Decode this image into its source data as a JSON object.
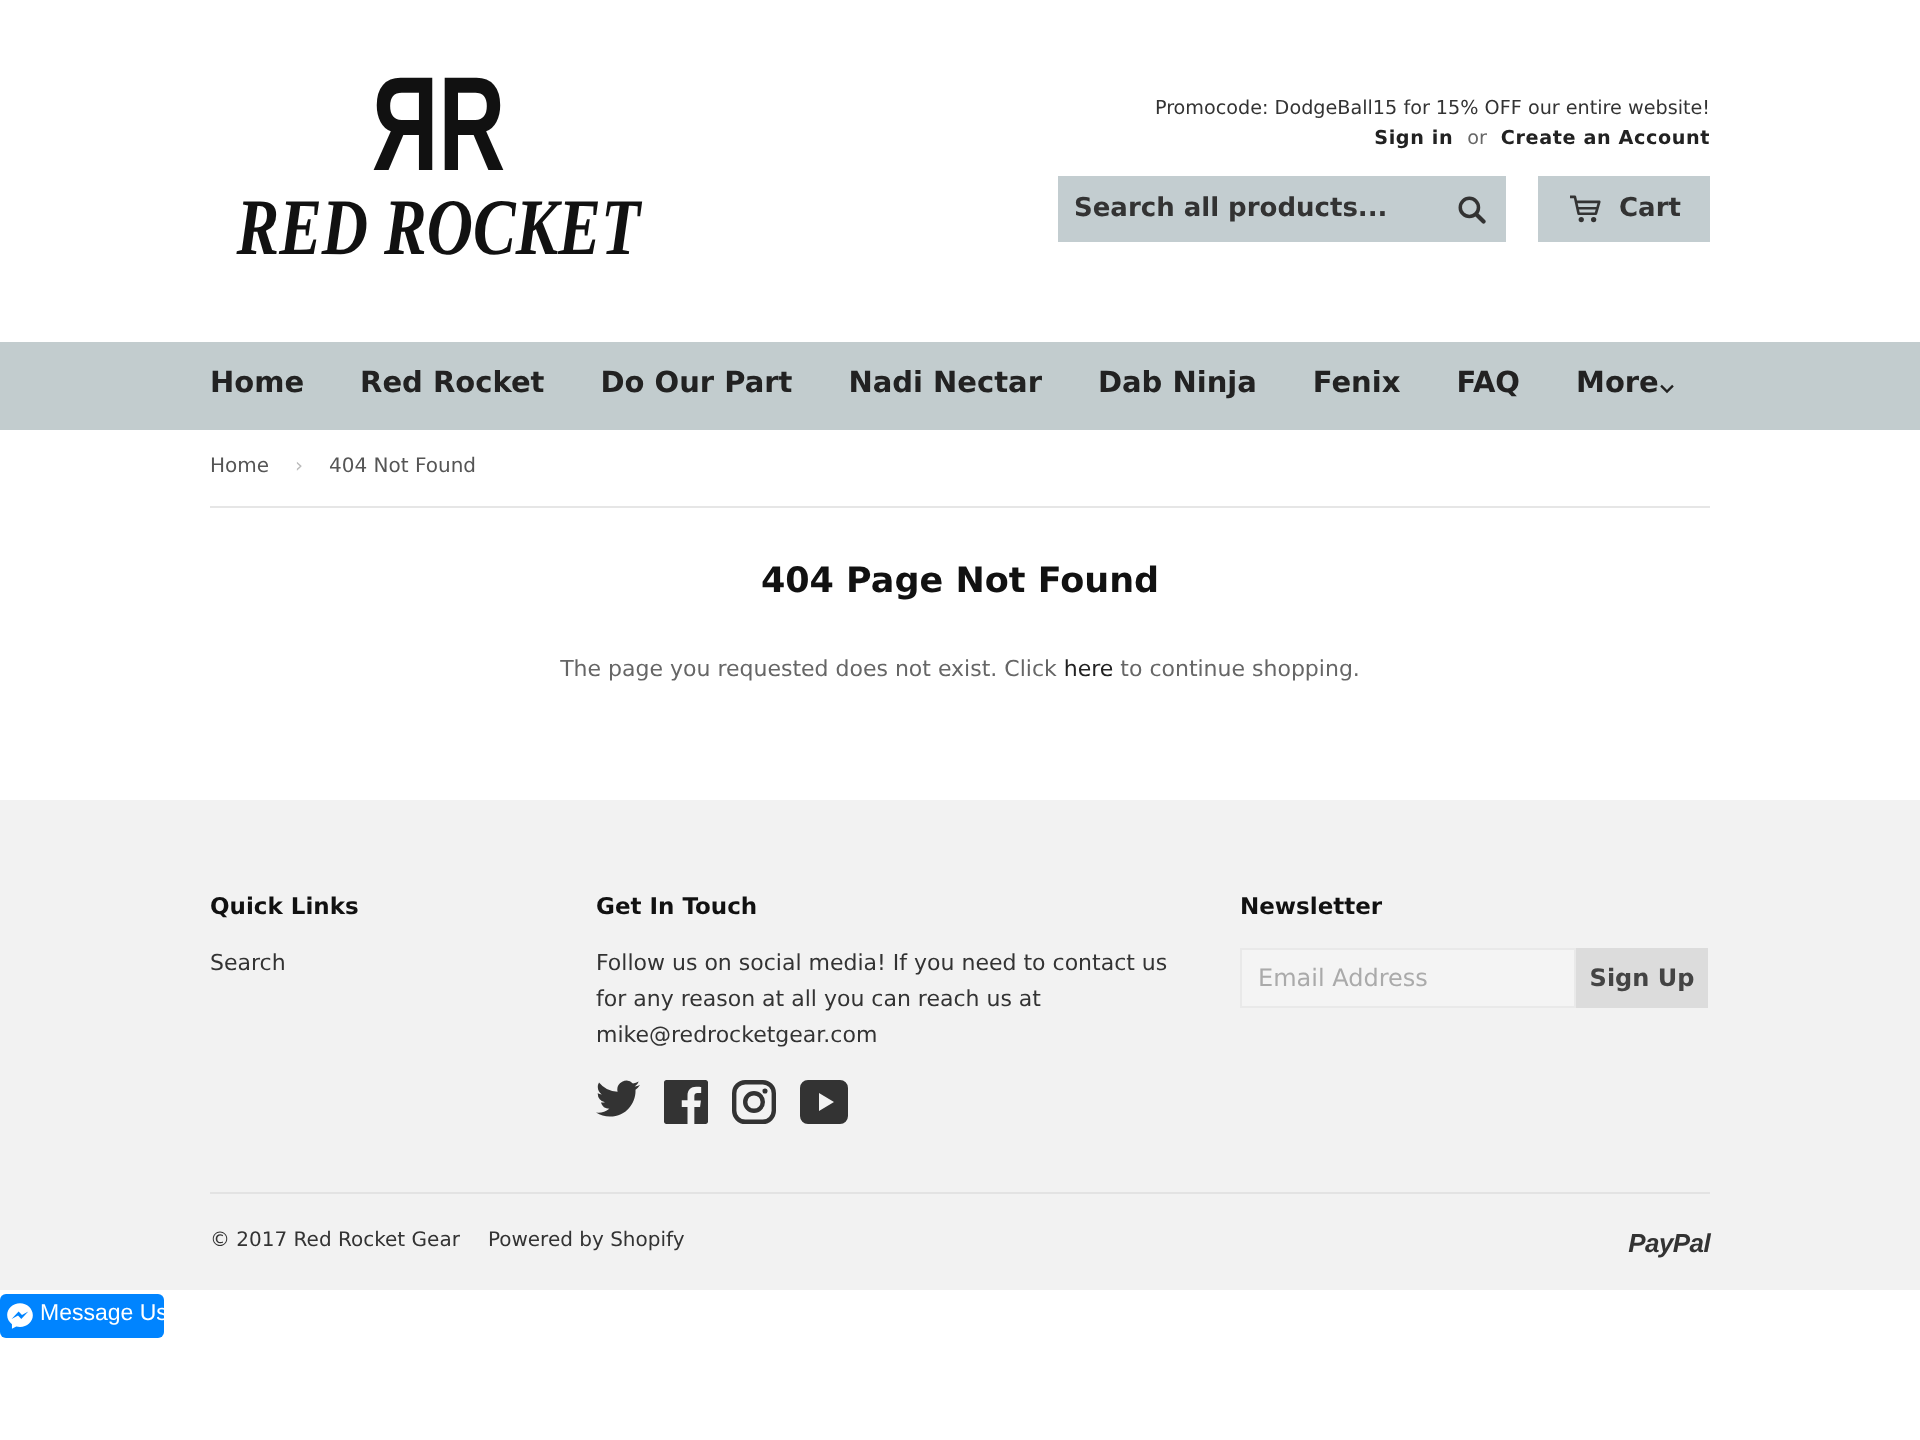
{
  "header": {
    "logo": {
      "monogram": "ЯR",
      "wordmark": "RED ROCKET"
    },
    "promo": "Promocode: DodgeBall15 for 15% OFF our entire website!",
    "account": {
      "links": [
        "Sign in",
        "Create an Account"
      ],
      "separator": "or"
    },
    "search": {
      "placeholder": "Search all products..."
    },
    "cart": {
      "label": "Cart"
    }
  },
  "nav": [
    {
      "label": "Home",
      "dropdown": false
    },
    {
      "label": "Red Rocket",
      "dropdown": false
    },
    {
      "label": "Do Our Part",
      "dropdown": false
    },
    {
      "label": "Nadi Nectar",
      "dropdown": false
    },
    {
      "label": "Dab Ninja",
      "dropdown": false
    },
    {
      "label": "Fenix",
      "dropdown": false
    },
    {
      "label": "FAQ",
      "dropdown": false
    },
    {
      "label": "More",
      "dropdown": true
    }
  ],
  "breadcrumb": {
    "items": [
      "Home",
      "404 Not Found"
    ],
    "separator": "›"
  },
  "page": {
    "title": "404 Page Not Found",
    "message": {
      "before": "The page you requested does not exist. Click ",
      "link": "here",
      "after": " to continue shopping."
    }
  },
  "footer": {
    "quick_links": {
      "title": "Quick Links",
      "links": [
        "Search"
      ]
    },
    "get_in_touch": {
      "title": "Get In Touch",
      "text": "Follow us on social media! If you need to contact us for any reason at all you can reach us at mike@redrocketgear.com",
      "social": [
        {
          "kind": "bird"
        },
        {
          "kind": "f"
        },
        {
          "kind": "camera"
        },
        {
          "kind": "play"
        }
      ]
    },
    "newsletter": {
      "title": "Newsletter",
      "placeholder": "Email Address",
      "button": "Sign Up"
    },
    "copyright": "© 2017 Red Rocket Gear",
    "powered_by": "Powered by Shopify",
    "payment": "PayPal"
  },
  "message_button": {
    "label": "Message Us"
  }
}
